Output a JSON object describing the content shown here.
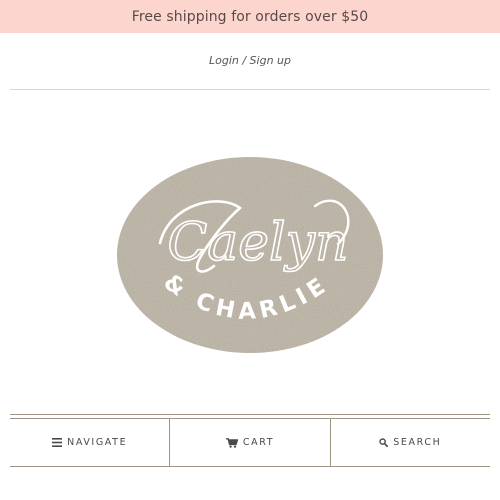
{
  "promo": {
    "text": "Free shipping for orders over $50"
  },
  "account": {
    "login_label": "Login / Sign up"
  },
  "logo": {
    "script_text": "Caelyn",
    "subtitle_text": "& CHARLIE",
    "badge_color": "#b3ab9b",
    "ink_color": "#ffffff"
  },
  "nav": {
    "items": [
      {
        "label": "NAVIGATE",
        "icon": "menu-icon"
      },
      {
        "label": "CART",
        "icon": "cart-icon"
      },
      {
        "label": "SEARCH",
        "icon": "search-icon"
      }
    ]
  },
  "colors": {
    "promo_bg": "#fdd5cf",
    "promo_text": "#5a4a47",
    "rule": "#9e9683"
  }
}
